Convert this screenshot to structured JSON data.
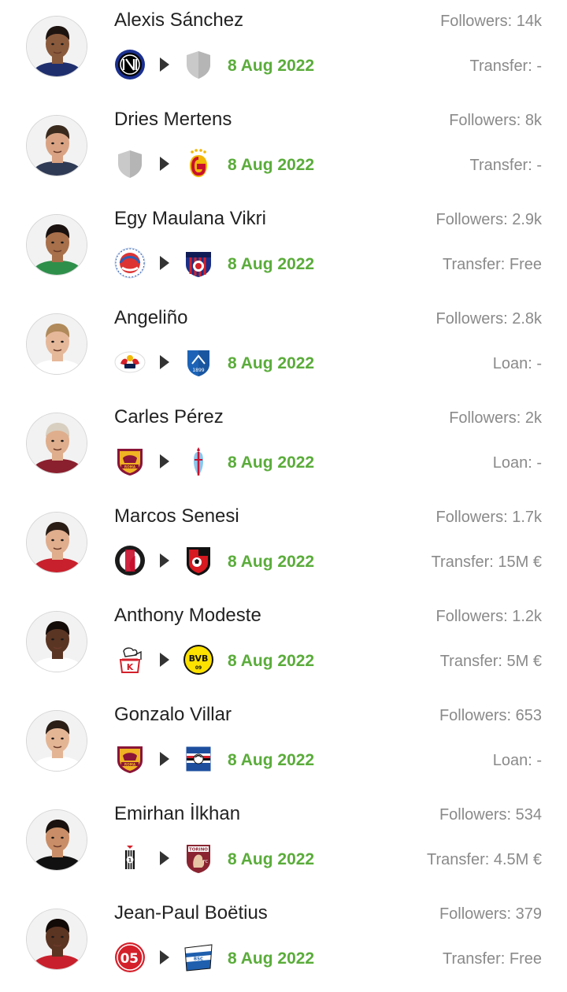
{
  "colors": {
    "date_green": "#5aac3a",
    "meta_grey": "#8a8a8a",
    "name_text": "#222222",
    "arrow": "#333333"
  },
  "arrow_icon": "right-triangle-icon",
  "rows": [
    {
      "name": "Alexis Sánchez",
      "followers": "Followers: 14k",
      "date": "8 Aug 2022",
      "deal": "Transfer: -",
      "from_club": "inter-crest-icon",
      "to_club": "unknown-club-shield-icon",
      "skin": "#8a5a3c",
      "hair": "#1d1410",
      "shirt": "#1f2f6e"
    },
    {
      "name": "Dries Mertens",
      "followers": "Followers: 8k",
      "date": "8 Aug 2022",
      "deal": "Transfer: -",
      "from_club": "unknown-club-shield-icon",
      "to_club": "galatasaray-crest-icon",
      "skin": "#d9a383",
      "hair": "#3a2a1e",
      "shirt": "#2f3a55"
    },
    {
      "name": "Egy Maulana Vikri",
      "followers": "Followers: 2.9k",
      "date": "8 Aug 2022",
      "deal": "Transfer: Free",
      "from_club": "senica-crest-icon",
      "to_club": "vitkovice-crest-icon",
      "skin": "#a8704b",
      "hair": "#1a1210",
      "shirt": "#2e8f4a"
    },
    {
      "name": "Angeliño",
      "followers": "Followers: 2.8k",
      "date": "8 Aug 2022",
      "deal": "Loan: -",
      "from_club": "rb-leipzig-crest-icon",
      "to_club": "hoffenheim-crest-icon",
      "skin": "#e6b89a",
      "hair": "#b08a5a",
      "shirt": "#ffffff"
    },
    {
      "name": "Carles Pérez",
      "followers": "Followers: 2k",
      "date": "8 Aug 2022",
      "deal": "Loan: -",
      "from_club": "as-roma-crest-icon",
      "to_club": "celta-vigo-crest-icon",
      "skin": "#dfae8c",
      "hair": "#d8cfc0",
      "shirt": "#8a1f2e"
    },
    {
      "name": "Marcos Senesi",
      "followers": "Followers: 1.7k",
      "date": "8 Aug 2022",
      "deal": "Transfer: 15M €",
      "from_club": "feyenoord-crest-icon",
      "to_club": "bournemouth-crest-icon",
      "skin": "#e0ad8d",
      "hair": "#2a1d16",
      "shirt": "#c8202c"
    },
    {
      "name": "Anthony Modeste",
      "followers": "Followers: 1.2k",
      "date": "8 Aug 2022",
      "deal": "Transfer: 5M €",
      "from_club": "fc-koln-crest-icon",
      "to_club": "dortmund-crest-icon",
      "skin": "#5a3524",
      "hair": "#140c08",
      "shirt": "#ffffff"
    },
    {
      "name": "Gonzalo Villar",
      "followers": "Followers: 653",
      "date": "8 Aug 2022",
      "deal": "Loan: -",
      "from_club": "as-roma-crest-icon",
      "to_club": "sampdoria-crest-icon",
      "skin": "#e4b595",
      "hair": "#2a1e16",
      "shirt": "#ffffff"
    },
    {
      "name": "Emirhan İlkhan",
      "followers": "Followers: 534",
      "date": "8 Aug 2022",
      "deal": "Transfer: 4.5M €",
      "from_club": "besiktas-crest-icon",
      "to_club": "torino-crest-icon",
      "skin": "#c98e67",
      "hair": "#1a120e",
      "shirt": "#111111"
    },
    {
      "name": "Jean-Paul Boëtius",
      "followers": "Followers: 379",
      "date": "8 Aug 2022",
      "deal": "Transfer: Free",
      "from_club": "mainz-crest-icon",
      "to_club": "hertha-crest-icon",
      "skin": "#5c3422",
      "hair": "#120a07",
      "shirt": "#c8202c"
    }
  ]
}
